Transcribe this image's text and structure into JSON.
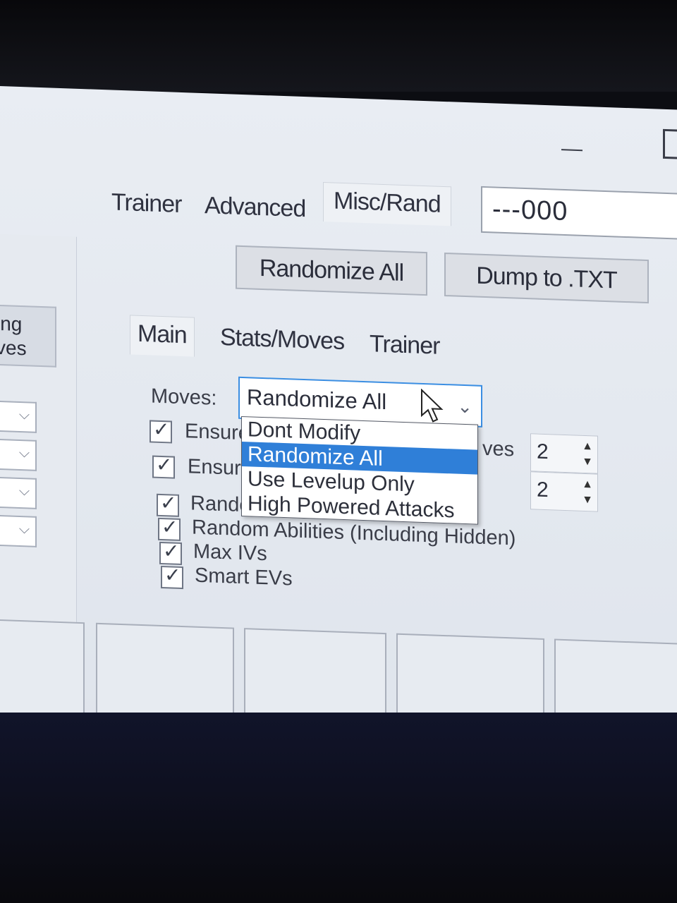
{
  "window": {
    "minimize_glyph": "—"
  },
  "left_panel": {
    "button_label_line1": "ing",
    "button_label_line2": "ves"
  },
  "top_tabs": [
    "Trainer",
    "Advanced",
    "Misc/Rand"
  ],
  "serial_field": {
    "value": "---000"
  },
  "buttons": {
    "randomize_all": "Randomize All",
    "dump_txt": "Dump to .TXT"
  },
  "sub_tabs": [
    "Main",
    "Stats/Moves",
    "Trainer"
  ],
  "moves": {
    "label": "Moves:",
    "selected": "Randomize All",
    "options": [
      "Dont Modify",
      "Randomize All",
      "Use Levelup Only",
      "High Powered Attacks"
    ],
    "highlighted_index": 1
  },
  "checkboxes": [
    {
      "label": "Ensure",
      "checked": true
    },
    {
      "label": "Ensure",
      "checked": true
    },
    {
      "label": "Random Held Items",
      "checked": true
    },
    {
      "label": "Random Abilities (Including Hidden)",
      "checked": true
    },
    {
      "label": "Max IVs",
      "checked": true
    },
    {
      "label": "Smart EVs",
      "checked": true
    }
  ],
  "spinners": [
    {
      "suffix": "ves",
      "value": "2"
    },
    {
      "value": "2"
    }
  ],
  "colors": {
    "selection": "#2f7fd8",
    "focus_border": "#3b8ee2"
  }
}
